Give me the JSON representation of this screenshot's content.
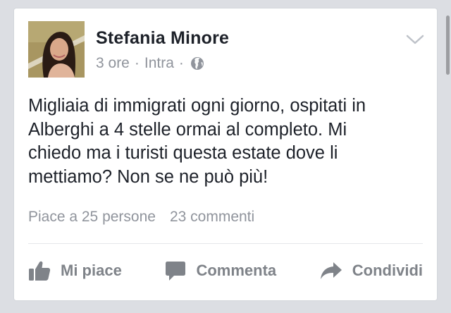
{
  "post": {
    "author": "Stefania Minore",
    "time": "3 ore",
    "separator": "·",
    "audience": "Intra",
    "audience_icon": "globe-icon",
    "text": "Migliaia di immigrati ogni giorno, ospitati in\nAlberghi a 4 stelle ormai al completo. Mi\nchiedo ma i turisti questa estate dove li\nmettiamo? Non se ne può più!",
    "likes": "Piace a 25 persone",
    "comments": "23 commenti",
    "menu_icon": "chevron-down-icon"
  },
  "actions": {
    "like": {
      "label": "Mi piace",
      "icon": "thumbs-up-icon"
    },
    "comment": {
      "label": "Commenta",
      "icon": "comment-icon"
    },
    "share": {
      "label": "Condividi",
      "icon": "share-icon"
    }
  },
  "colors": {
    "background": "#dcdee3",
    "card": "#ffffff",
    "text": "#1d2129",
    "secondary": "#90949c",
    "action": "#7f8389"
  }
}
